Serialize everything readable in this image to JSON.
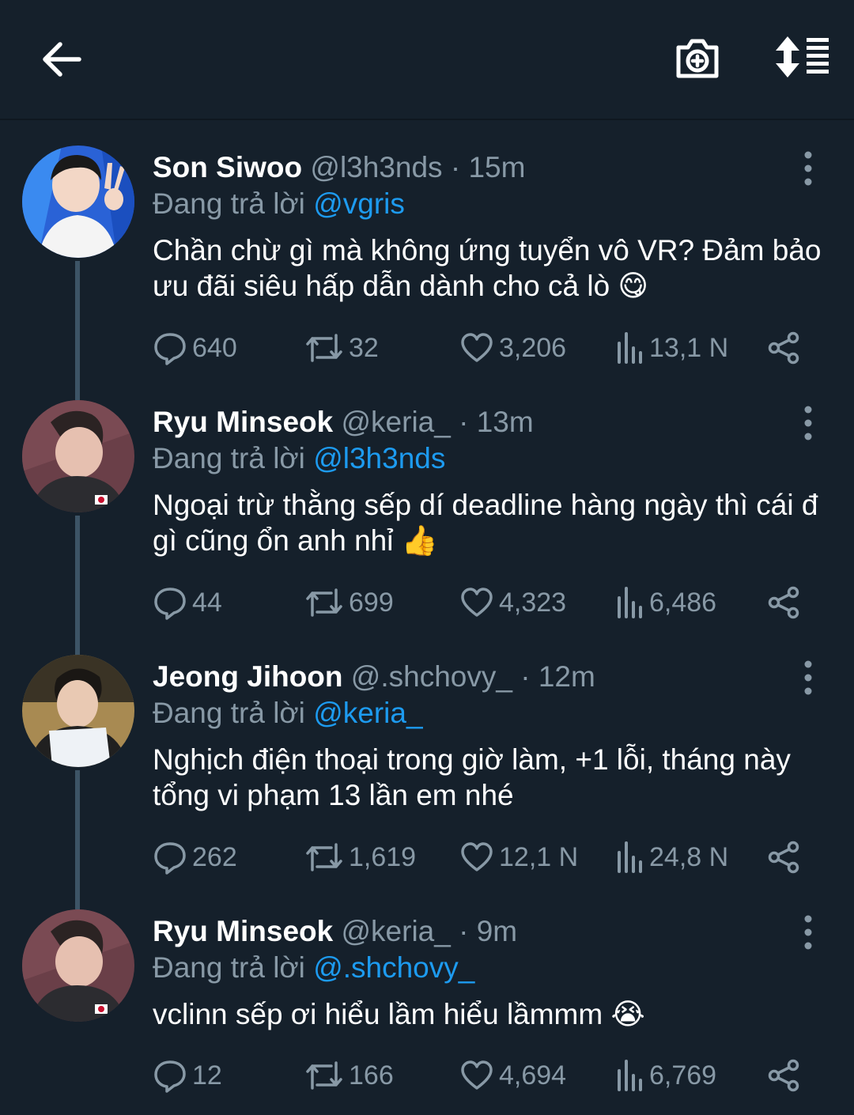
{
  "header": {
    "back_icon": "arrow-left-icon",
    "camera_icon": "camera-add-icon",
    "sort_icon": "sort-list-icon"
  },
  "tweets": [
    {
      "name": "Son Siwoo",
      "handle": "@l3h3nds",
      "sep": "·",
      "time": "15m",
      "reply_prefix": "Đang trả lời",
      "reply_to": "@vgris",
      "text": "Chần chừ gì mà không ứng tuyển vô VR? Đảm bảo ưu đãi siêu hấp dẫn dành cho cả lò 😋",
      "replies": "640",
      "retweets": "32",
      "likes": "3,206",
      "views": "13,1 N"
    },
    {
      "name": "Ryu Minseok",
      "handle": "@keria_",
      "sep": "·",
      "time": "13m",
      "reply_prefix": "Đang trả lời",
      "reply_to": "@l3h3nds",
      "text": "Ngoại trừ thằng sếp dí deadline hàng ngày thì cái đ gì cũng ổn anh nhỉ 👍",
      "replies": "44",
      "retweets": "699",
      "likes": "4,323",
      "views": "6,486"
    },
    {
      "name": "Jeong Jihoon",
      "handle": "@.shchovy_",
      "sep": "·",
      "time": "12m",
      "reply_prefix": "Đang trả lời",
      "reply_to": "@keria_",
      "text": "Nghịch điện thoại trong giờ làm, +1 lỗi, tháng này tổng vi phạm 13 lần em nhé",
      "replies": "262",
      "retweets": "1,619",
      "likes": "12,1 N",
      "views": "24,8 N"
    },
    {
      "name": "Ryu Minseok",
      "handle": "@keria_",
      "sep": "·",
      "time": "9m",
      "reply_prefix": "Đang trả lời",
      "reply_to": "@.shchovy_",
      "text": "vclinn sếp ơi hiểu lầm hiểu lầmmm 😭",
      "replies": "12",
      "retweets": "166",
      "likes": "4,694",
      "views": "6,769"
    }
  ],
  "colors": {
    "background": "#15202b",
    "muted": "#8899a6",
    "link": "#1d9bf0",
    "thread_line": "#3d5466"
  }
}
